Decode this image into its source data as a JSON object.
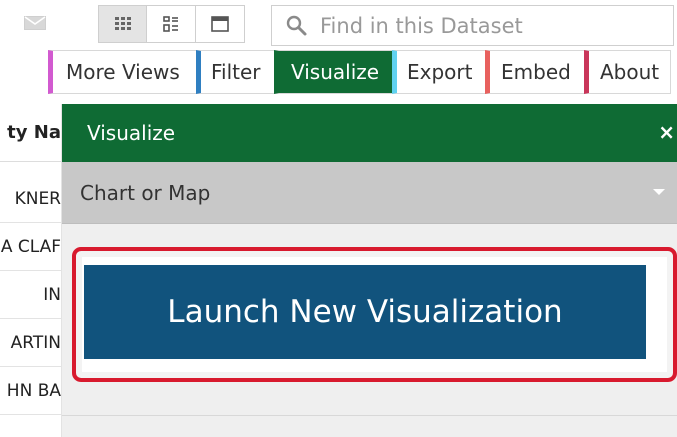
{
  "search": {
    "placeholder": "Find in this Dataset"
  },
  "tabs": [
    {
      "label": "More Views"
    },
    {
      "label": "Filter"
    },
    {
      "label": "Visualize"
    },
    {
      "label": "Export"
    },
    {
      "label": "Embed"
    },
    {
      "label": "About"
    }
  ],
  "table": {
    "header": "ty Na",
    "rows": [
      "KNER",
      "A CLAF",
      "IN",
      "ARTIN",
      "HN BA"
    ]
  },
  "panel": {
    "title": "Visualize",
    "close": "×",
    "dropdown_label": "Chart or Map",
    "launch_label": "Launch New Visualization"
  },
  "colors": {
    "visualize_green": "#0f6b34",
    "launch_blue": "#11537d",
    "highlight_red": "#d81a2e"
  }
}
